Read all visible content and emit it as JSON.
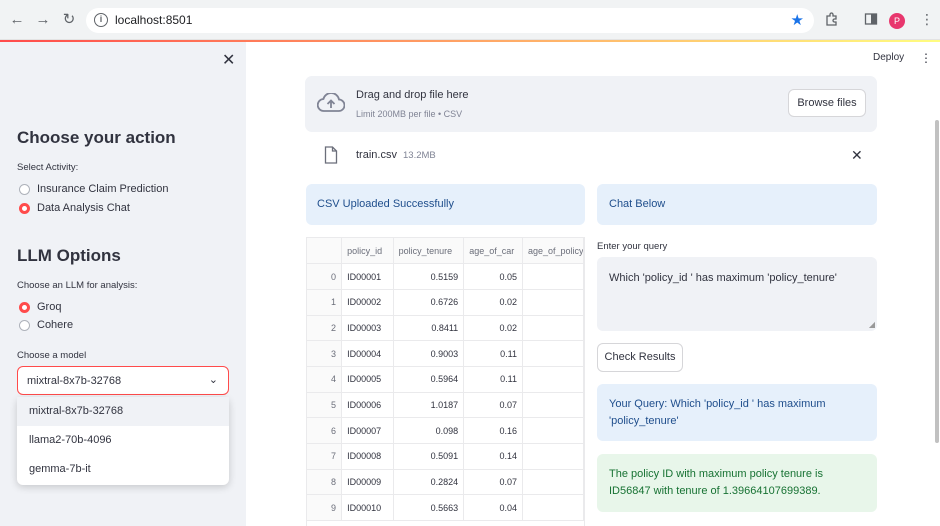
{
  "browser": {
    "url": "localhost:8501",
    "profile_initial": "P"
  },
  "app": {
    "deploy_label": "Deploy"
  },
  "sidebar": {
    "action_title": "Choose your action",
    "select_activity_label": "Select Activity:",
    "activities": [
      {
        "label": "Insurance Claim Prediction",
        "selected": false
      },
      {
        "label": "Data Analysis Chat",
        "selected": true
      }
    ],
    "llm_title": "LLM Options",
    "llm_label": "Choose an LLM for analysis:",
    "llms": [
      {
        "label": "Groq",
        "selected": true
      },
      {
        "label": "Cohere",
        "selected": false
      }
    ],
    "model_label": "Choose a model",
    "model_selected": "mixtral-8x7b-32768",
    "model_options": [
      "mixtral-8x7b-32768",
      "llama2-70b-4096",
      "gemma-7b-it"
    ]
  },
  "uploader": {
    "drag_text": "Drag and drop file here",
    "limit_text": "Limit 200MB per file • CSV",
    "browse_label": "Browse files",
    "file_name": "train.csv",
    "file_size": "13.2MB"
  },
  "status": {
    "csv_uploaded": "CSV Uploaded Successfully",
    "chat_below": "Chat Below"
  },
  "dataframe": {
    "columns": [
      "",
      "policy_id",
      "policy_tenure",
      "age_of_car",
      "age_of_policyholder"
    ],
    "rows": [
      [
        "0",
        "ID00001",
        "0.5159",
        "0.05",
        ""
      ],
      [
        "1",
        "ID00002",
        "0.6726",
        "0.02",
        ""
      ],
      [
        "2",
        "ID00003",
        "0.8411",
        "0.02",
        ""
      ],
      [
        "3",
        "ID00004",
        "0.9003",
        "0.11",
        ""
      ],
      [
        "4",
        "ID00005",
        "0.5964",
        "0.11",
        ""
      ],
      [
        "5",
        "ID00006",
        "1.0187",
        "0.07",
        ""
      ],
      [
        "6",
        "ID00007",
        "0.098",
        "0.16",
        ""
      ],
      [
        "7",
        "ID00008",
        "0.5091",
        "0.14",
        ""
      ],
      [
        "8",
        "ID00009",
        "0.2824",
        "0.07",
        ""
      ],
      [
        "9",
        "ID00010",
        "0.5663",
        "0.04",
        ""
      ]
    ]
  },
  "chat": {
    "query_label": "Enter your query",
    "query_value": "Which 'policy_id ' has maximum 'policy_tenure'",
    "check_button": "Check Results",
    "your_query": "Your Query: Which 'policy_id ' has maximum 'policy_tenure'",
    "result": "The policy ID with maximum policy tenure is ID56847 with tenure of 1.39664107699389."
  },
  "colors": {
    "accent": "#ff4b4b",
    "info_bg": "#e6f0fb",
    "success_bg": "#e8f6ea",
    "sidebar_bg": "#f0f2f6"
  }
}
